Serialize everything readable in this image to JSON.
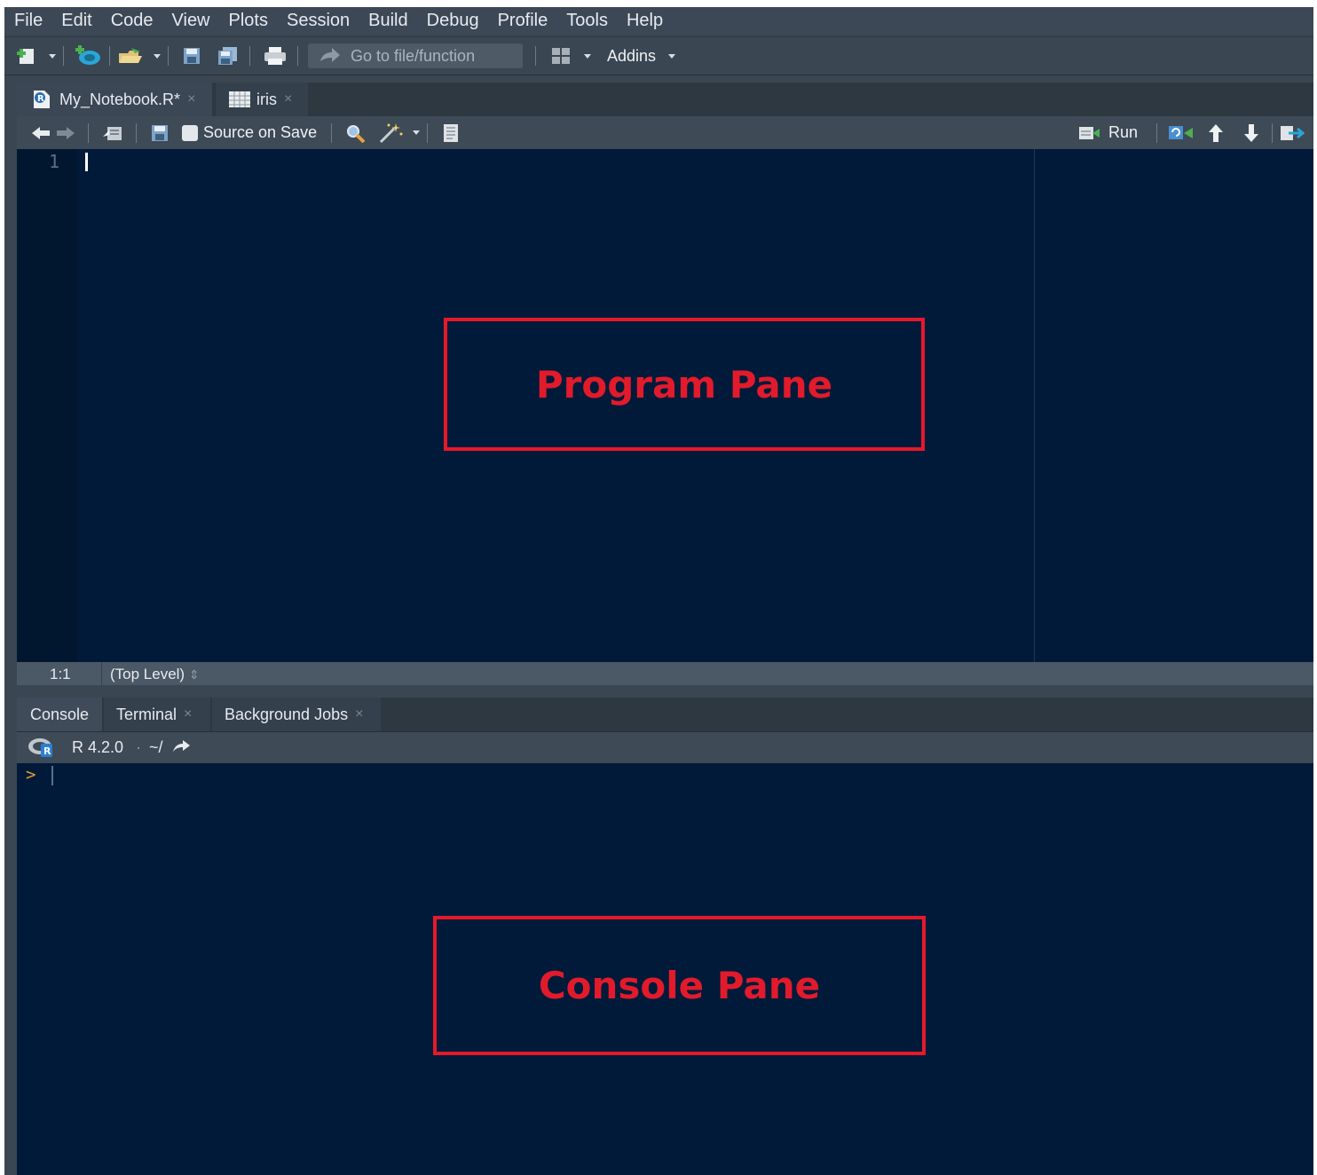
{
  "menu": [
    "File",
    "Edit",
    "Code",
    "View",
    "Plots",
    "Session",
    "Build",
    "Debug",
    "Profile",
    "Tools",
    "Help"
  ],
  "toolbar": {
    "goto_placeholder": "Go to file/function",
    "addins_label": "Addins"
  },
  "source": {
    "tabs": [
      {
        "label": "My_Notebook.R*",
        "icon": "r-script-icon",
        "close": "×"
      },
      {
        "label": "iris",
        "icon": "table-icon",
        "close": "×"
      }
    ],
    "source_on_save_label": "Source on Save",
    "source_on_save_checked": false,
    "run_label": "Run",
    "line_number": "1",
    "status_position": "1:1",
    "status_scope": "(Top Level)",
    "status_scope_arrows": "⇕"
  },
  "console": {
    "tabs": [
      {
        "label": "Console",
        "close": ""
      },
      {
        "label": "Terminal",
        "close": "×"
      },
      {
        "label": "Background Jobs",
        "close": "×"
      }
    ],
    "r_version": "R 4.2.0",
    "separator": "·",
    "working_dir": "~/",
    "prompt": ">"
  },
  "annotations": {
    "program_pane": "Program Pane",
    "console_pane": "Console Pane",
    "color": "#e5192a"
  },
  "colors": {
    "editor_bg": "#011a3a",
    "chrome": "#3a4652",
    "accent": "#2aa6d6"
  }
}
